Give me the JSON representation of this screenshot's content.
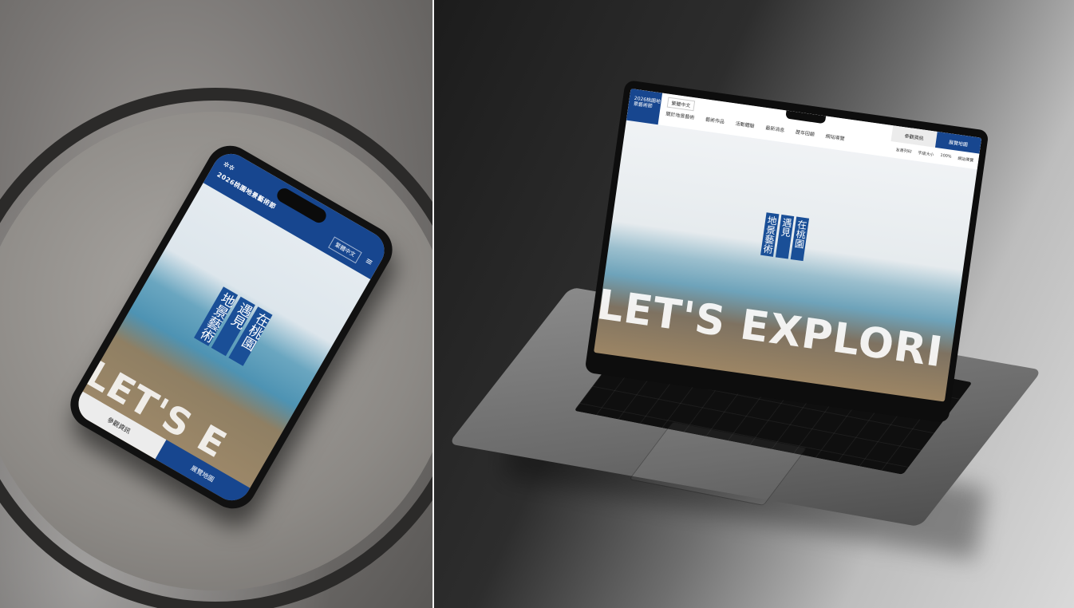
{
  "phone": {
    "logo_text": "2026桃園地景藝術節",
    "lang_select": "繁體中文",
    "menu_icon": "hamburger-menu-icon",
    "hero_title": [
      "在桃園",
      "遇見",
      "地景藝術"
    ],
    "hero_banner": "LET'S E",
    "button_info": "參觀資訊",
    "button_map": "展覽地圖"
  },
  "laptop": {
    "logo_text": "2026桃園地景藝術節",
    "lang_select": "繁體中文",
    "nav": [
      "關於地景藝術",
      "藝術作品",
      "活動體驗",
      "最新消息",
      "歷年回顧",
      "網站導覽"
    ],
    "tab_info": "參觀資訊",
    "tab_map": "展覽地圖",
    "util": [
      "友善列印",
      "字級大小",
      "100%",
      "網站導覽"
    ],
    "hero_title": [
      "在桃園",
      "遇見",
      "地景藝術"
    ],
    "hero_banner": "LET'S EXPLORI"
  },
  "colors": {
    "brand_blue": "#17468f",
    "sea_blue": "#4e93b3",
    "sand": "#9c8564"
  }
}
